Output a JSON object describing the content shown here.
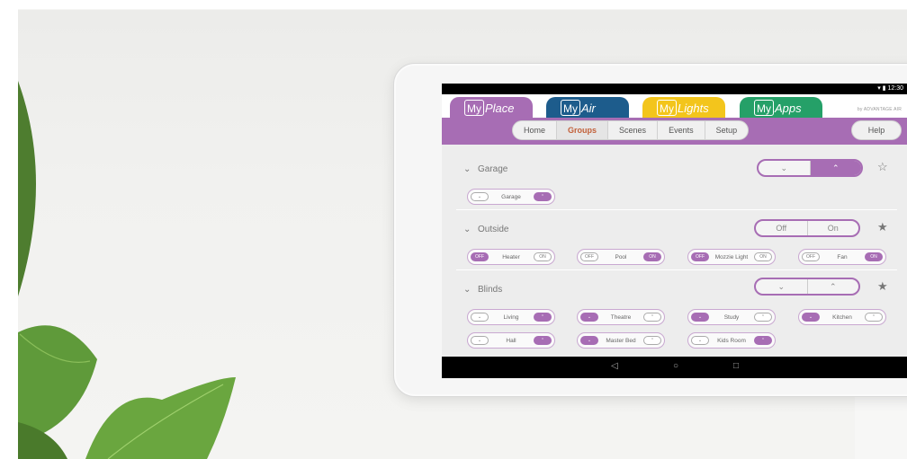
{
  "status": {
    "time": "12:30"
  },
  "apps": {
    "myplace": {
      "my": "My",
      "name": "Place",
      "color": "#a76db4"
    },
    "myair": {
      "my": "My",
      "name": "Air",
      "color": "#1d5c8c"
    },
    "mylights": {
      "my": "My",
      "name": "Lights",
      "color": "#f3c51c"
    },
    "myapps": {
      "my": "My",
      "name": "Apps",
      "color": "#25a068"
    }
  },
  "brand": "by ADVANTAGE AIR",
  "nav": {
    "home": "Home",
    "groups": "Groups",
    "scenes": "Scenes",
    "events": "Events",
    "setup": "Setup",
    "help": "Help"
  },
  "groups": {
    "garage": {
      "title": "Garage",
      "toggle": {
        "down": "⌄",
        "up": "⌃"
      },
      "items": [
        {
          "label": "Garage"
        }
      ]
    },
    "outside": {
      "title": "Outside",
      "toggle": {
        "off": "Off",
        "on": "On"
      },
      "items": [
        {
          "label": "Heater",
          "off": "OFF",
          "on": "ON"
        },
        {
          "label": "Pool",
          "off": "OFF",
          "on": "ON"
        },
        {
          "label": "Mozzie Light",
          "off": "OFF",
          "on": "ON"
        },
        {
          "label": "Fan",
          "off": "OFF",
          "on": "ON"
        }
      ]
    },
    "blinds": {
      "title": "Blinds",
      "items": [
        {
          "label": "Living"
        },
        {
          "label": "Theatre"
        },
        {
          "label": "Study"
        },
        {
          "label": "Kitchen"
        },
        {
          "label": "Hall"
        },
        {
          "label": "Master Bed"
        },
        {
          "label": "Kids Room"
        }
      ]
    }
  },
  "icons": {
    "chevron": "chevron-down-icon",
    "star": "star-icon",
    "back": "back-icon",
    "home": "home-icon",
    "recents": "recents-icon"
  },
  "colors": {
    "accent": "#a76db4",
    "leaf": "#5f9a3a"
  }
}
